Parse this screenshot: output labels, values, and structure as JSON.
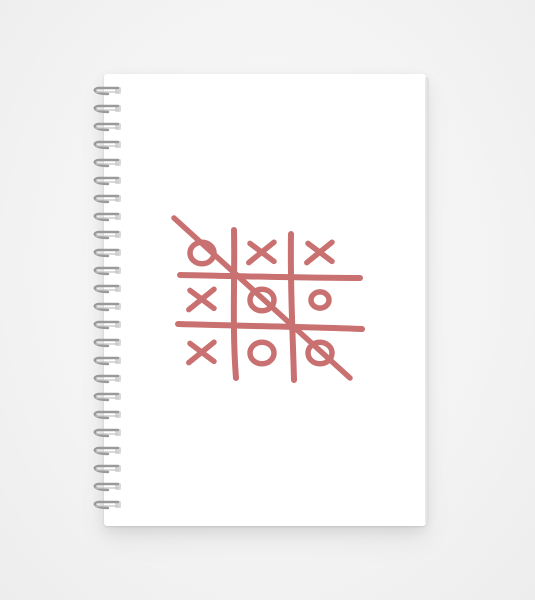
{
  "product": {
    "type": "spiral-notebook",
    "cover_color": "#ffffff",
    "binding_color": "#9a9a9a"
  },
  "artwork": {
    "motif": "tic-tac-toe-board",
    "ink_color": "#c97070",
    "board": [
      [
        "O",
        "X",
        "X"
      ],
      [
        "X",
        "O",
        "O"
      ],
      [
        "X",
        "O",
        "O"
      ]
    ]
  }
}
